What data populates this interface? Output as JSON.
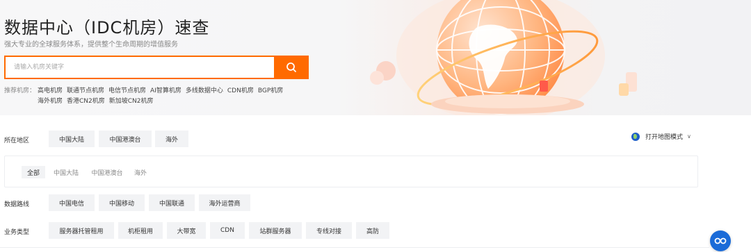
{
  "hero": {
    "title": "数据中心（IDC机房）速查",
    "subtitle": "强大专业的全球服务体系，提供整个生命周期的增值服务"
  },
  "search": {
    "placeholder": "请输入机房关键字"
  },
  "recommend": {
    "label": "推荐机房：",
    "items": [
      "高电机房",
      "联通节点机房",
      "电信节点机房",
      "AI智算机房",
      "多线数据中心",
      "CDN机房",
      "BGP机房",
      "海外机房",
      "香港CN2机房",
      "新加坡CN2机房"
    ]
  },
  "filters": {
    "region": {
      "label": "所在地区",
      "options": [
        "中国大陆",
        "中国港澳台",
        "海外"
      ]
    },
    "sub_region": {
      "options": [
        "全部",
        "中国大陆",
        "中国港澳台",
        "海外"
      ],
      "selected": "全部"
    },
    "line": {
      "label": "数据路线",
      "options": [
        "中国电信",
        "中国移动",
        "中国联通",
        "海外运营商"
      ]
    },
    "business": {
      "label": "业务类型",
      "options": [
        "服务器托管租用",
        "机柜租用",
        "大带宽",
        "CDN",
        "站群服务器",
        "专线对接",
        "高防"
      ]
    }
  },
  "map_toggle": {
    "label": "打开地图模式",
    "chevron": "∨"
  },
  "colors": {
    "accent": "#ff6a00",
    "chip_bg": "#f2f3f5",
    "float_button": "#1a6bd8"
  },
  "icons": {
    "search": "search-icon",
    "globe": "globe-icon",
    "chevron": "chevron-down-icon",
    "float": "assistant-icon"
  }
}
